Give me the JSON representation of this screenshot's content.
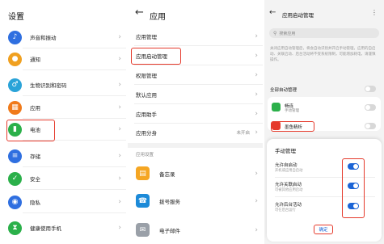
{
  "settings": {
    "title": "设置",
    "items": [
      {
        "label": "声音和振动",
        "icon": "sound-icon",
        "color": "#2f6fe0"
      },
      {
        "label": "通知",
        "icon": "bell-icon",
        "color": "#f0a020"
      },
      {
        "label": "生物识别和密码",
        "icon": "key-icon",
        "color": "#2aa3d8"
      },
      {
        "label": "应用",
        "icon": "apps-icon",
        "color": "#f07a1a"
      },
      {
        "label": "电池",
        "icon": "battery-icon",
        "color": "#2bb04a"
      },
      {
        "label": "存储",
        "icon": "storage-icon",
        "color": "#2f6fe0"
      },
      {
        "label": "安全",
        "icon": "shield-icon",
        "color": "#2bb04a"
      },
      {
        "label": "隐私",
        "icon": "privacy-icon",
        "color": "#2f6fe0"
      },
      {
        "label": "健康使用手机",
        "icon": "hourglass-icon",
        "color": "#2bb04a"
      }
    ]
  },
  "apps": {
    "title": "应用",
    "items": [
      {
        "label": "应用管理",
        "value": ""
      },
      {
        "label": "应用启动管理",
        "value": ""
      },
      {
        "label": "权限管理",
        "value": ""
      },
      {
        "label": "默认应用",
        "value": ""
      },
      {
        "label": "应用助手",
        "value": ""
      },
      {
        "label": "应用分身",
        "value": "未开启"
      }
    ],
    "section": "应用设置",
    "app_items": [
      {
        "label": "备忘录",
        "icon": "memo-icon",
        "color": "#f5a623"
      },
      {
        "label": "拨号服务",
        "icon": "phone-icon",
        "color": "#1c8ad8"
      },
      {
        "label": "电子邮件",
        "icon": "mail-icon",
        "color": "#9aa0a8"
      }
    ]
  },
  "launch": {
    "title": "应用启动管理",
    "search_placeholder": "搜索应用",
    "description": "关闭应用自动管理后，将会自动识别并开启手动管理，应用的自启动、关联启动、后台活动将不受系统限制，可能增加耗电，请谨慎操作。",
    "all_auto": "全部自动管理",
    "apps": [
      {
        "name": "畅连",
        "mode": "手动管理",
        "color": "#2bb04a"
      },
      {
        "name": "墨鱼精析",
        "mode": "",
        "color": "#e53a2c"
      }
    ]
  },
  "dialog": {
    "title": "手动管理",
    "options": [
      {
        "label": "允许自启动",
        "desc": "开机或应用自启动",
        "on": true
      },
      {
        "label": "允许关联启动",
        "desc": "可被其他应用启动",
        "on": true
      },
      {
        "label": "允许后台活动",
        "desc": "可在后台运行",
        "on": true
      }
    ],
    "ok": "确定"
  }
}
